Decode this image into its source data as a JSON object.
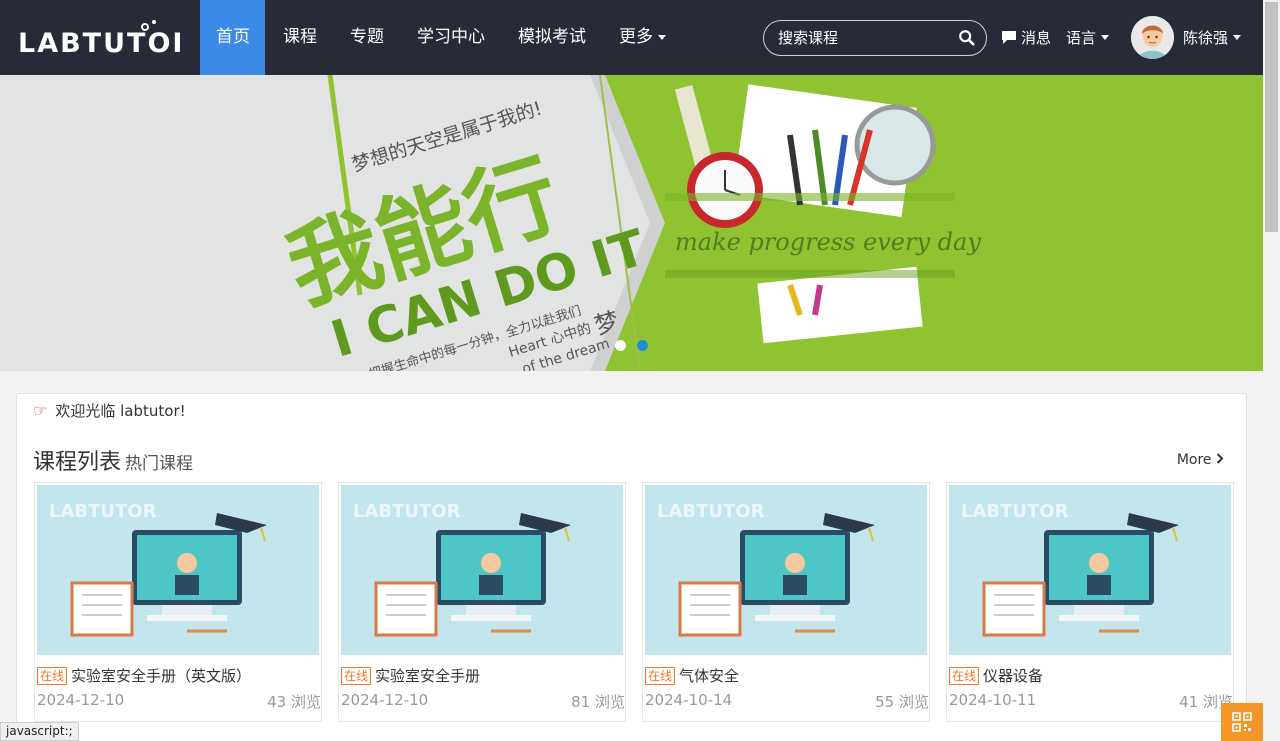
{
  "brand": {
    "logo_text": "LABTUTOR"
  },
  "nav": {
    "items": [
      {
        "label": "首页"
      },
      {
        "label": "课程"
      },
      {
        "label": "专题"
      },
      {
        "label": "学习中心"
      },
      {
        "label": "模拟考试"
      },
      {
        "label": "更多"
      }
    ],
    "search_placeholder": "搜索课程",
    "messages_label": "消息",
    "language_label": "语言",
    "user_name": "陈徐强"
  },
  "banner": {
    "line_dream": "梦想的天空是属于我的!",
    "big_title": "我能行",
    "slogan_en": "I CAN DO IT",
    "line_grasp": "把握生命中的每一分钟，全力以赴我们",
    "line_heart": "Heart 心中的",
    "line_dream_char": "梦",
    "line_of_dream": "of the dream",
    "script_text": "make progress every day",
    "slides_total": 2,
    "slide_active": 2
  },
  "welcome": {
    "text": "欢迎光临 labtutor!"
  },
  "course_list": {
    "title": "课程列表",
    "subtitle": "热门课程",
    "more_label": "More",
    "courses": [
      {
        "tag": "在线",
        "title": "实验室安全手册（英文版）",
        "date": "2024-12-10",
        "views": "43 浏览"
      },
      {
        "tag": "在线",
        "title": "实验室安全手册",
        "date": "2024-12-10",
        "views": "81 浏览"
      },
      {
        "tag": "在线",
        "title": "气体安全",
        "date": "2024-10-14",
        "views": "55 浏览"
      },
      {
        "tag": "在线",
        "title": "仪器设备",
        "date": "2024-10-11",
        "views": "41 浏览"
      }
    ]
  },
  "status_bar": {
    "text": "javascript:;"
  },
  "colors": {
    "nav_bg": "#272b38",
    "active_tab": "#3b8ae8",
    "banner_green": "#8fc331",
    "tag_orange": "#f07a2a",
    "qr_orange": "#f29629"
  }
}
